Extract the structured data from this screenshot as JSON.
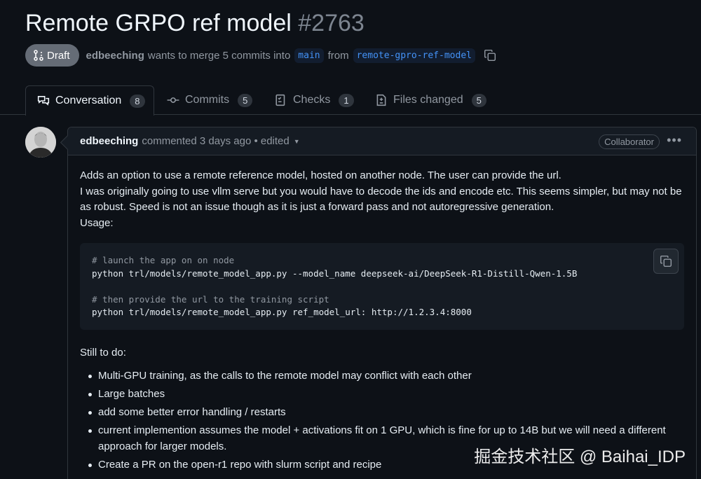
{
  "pr": {
    "title": "Remote GRPO ref model",
    "number": "#2763",
    "status": "Draft",
    "author": "edbeeching",
    "merge_text": "wants to merge 5 commits into",
    "base_branch": "main",
    "from_text": "from",
    "head_branch": "remote-gpro-ref-model"
  },
  "tabs": [
    {
      "label": "Conversation",
      "count": "8",
      "icon": "comment-discussion-icon"
    },
    {
      "label": "Commits",
      "count": "5",
      "icon": "git-commit-icon"
    },
    {
      "label": "Checks",
      "count": "1",
      "icon": "checklist-icon"
    },
    {
      "label": "Files changed",
      "count": "5",
      "icon": "file-diff-icon"
    }
  ],
  "comment": {
    "author": "edbeeching",
    "meta": "commented 3 days ago • edited",
    "badge": "Collaborator",
    "paragraphs": [
      "Adds an option to use a remote reference model, hosted on another node. The user can provide the url.",
      "I was originally going to use vllm serve but you would have to decode the ids and encode etc. This seems simpler, but may not be as robust. Speed is not an issue though as it is just a forward pass and not autoregressive generation.",
      "Usage:"
    ],
    "code": [
      "# launch the app on on node",
      "python trl/models/remote_model_app.py --model_name deepseek-ai/DeepSeek-R1-Distill-Qwen-1.5B",
      "",
      "# then provide the url to the training script",
      "python trl/models/remote_model_app.py ref_model_url: http://1.2.3.4:8000"
    ],
    "todo_title": "Still to do:",
    "todos": [
      "Multi-GPU training, as the calls to the remote model may conflict with each other",
      "Large batches",
      "add some better error handling / restarts",
      "current implemention assumes the model + activations fit on 1 GPU, which is fine for up to 14B but we will need a different approach for larger models.",
      "Create a PR on the open-r1 repo with slurm script and recipe"
    ]
  },
  "watermark": "掘金技术社区 @ Baihai_IDP",
  "colors": {
    "background": "#0d1117",
    "link": "#4493f8",
    "muted": "#9198a1",
    "draft": "#656c76"
  }
}
